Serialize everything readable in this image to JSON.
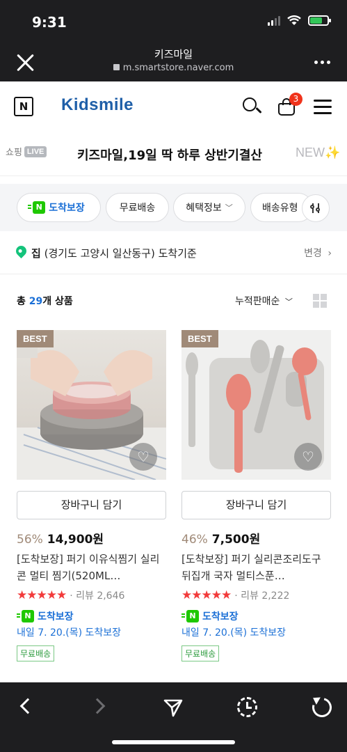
{
  "status": {
    "time": "9:31"
  },
  "browser": {
    "title": "키즈마일",
    "url": "m.smartstore.naver.com"
  },
  "store": {
    "brand": "Kidsmile",
    "n_logo": "N",
    "cart_count": "3"
  },
  "promo": {
    "shoplive_label": "쇼핑",
    "live_tag": "LIVE",
    "text": "키즈마일,19일 딱 하루 상반기결산",
    "new_text": "NEW✨"
  },
  "filters": {
    "arrival_guarantee": "도착보장",
    "n_mark": "N",
    "free_shipping": "무료배송",
    "benefit_info": "혜택정보",
    "shipping_type": "배송유형"
  },
  "location": {
    "label": "집",
    "address": "(경기도 고양시 일산동구) 도착기준",
    "change": "변경"
  },
  "list": {
    "count_prefix": "총 ",
    "count": "29",
    "count_suffix": "개 상품",
    "sort": "누적판매순"
  },
  "products": [
    {
      "badge": "BEST",
      "cart_button": "장바구니 담기",
      "discount": "56%",
      "price": "14,900원",
      "name": "[도착보장] 퍼기 이유식찜기 실리콘 멀티 찜기(520ML…",
      "stars": "★★★★★",
      "review": "· 리뷰 2,646",
      "arrival_badge": "도착보장",
      "arrival_date": "내일 7. 20.(목) 도착보장",
      "free_tag": "무료배송"
    },
    {
      "badge": "BEST",
      "cart_button": "장바구니 담기",
      "discount": "46%",
      "price": "7,500원",
      "name": "[도착보장] 퍼기 실리콘조리도구 뒤집개 국자 멀티스푼…",
      "stars": "★★★★★",
      "review": "· 리뷰 2,222",
      "arrival_badge": "도착보장",
      "arrival_date": "내일 7. 20.(목) 도착보장",
      "free_tag": "무료배송"
    }
  ],
  "colors": {
    "brand_blue": "#1f5fa8",
    "link_blue": "#1a6fd6",
    "badge_red": "#f0331b",
    "discount_brown": "#a08a78",
    "naver_green": "#1ec800"
  }
}
